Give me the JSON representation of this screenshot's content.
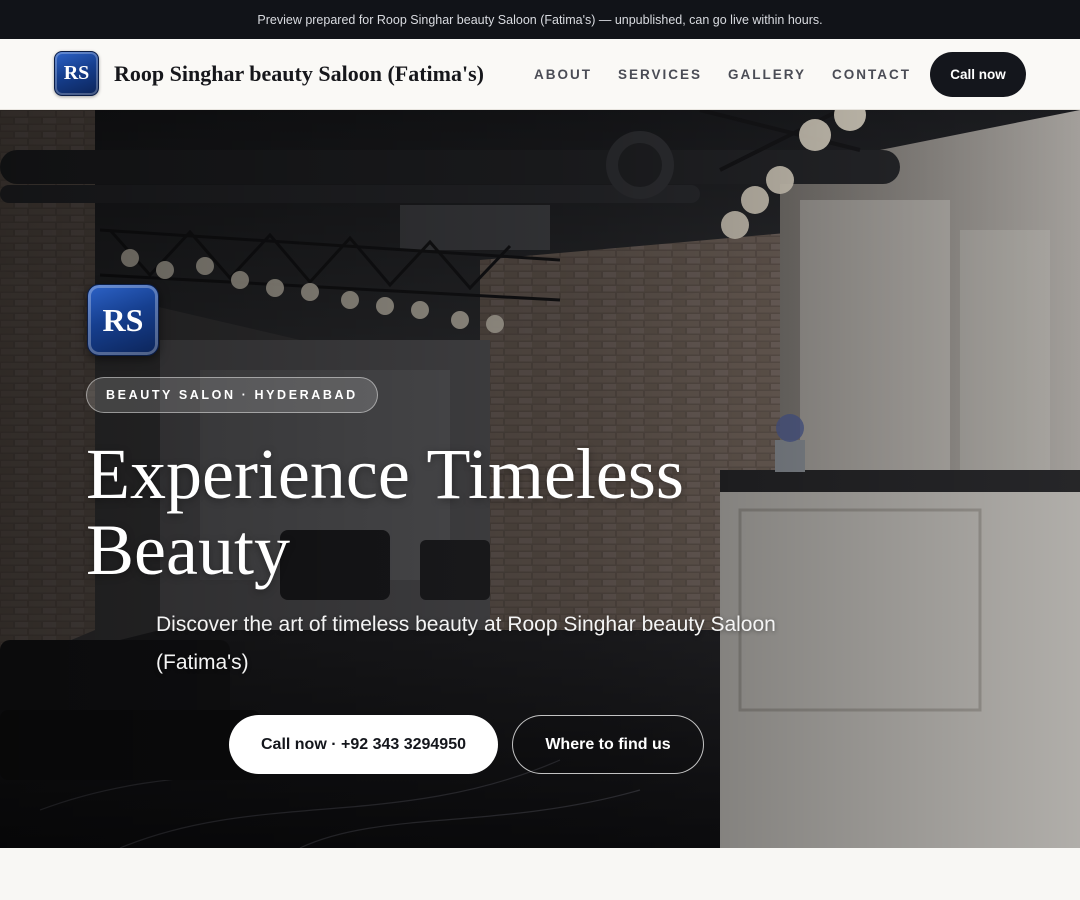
{
  "banner": {
    "text": "Preview prepared for Roop Singhar beauty Saloon (Fatima's) — unpublished, can go live within hours."
  },
  "brand": {
    "logo_initials": "RS",
    "name": "Roop Singhar beauty Saloon (Fatima's)"
  },
  "nav": {
    "links": [
      "ABOUT",
      "SERVICES",
      "GALLERY",
      "CONTACT"
    ],
    "cta_label": "Call now"
  },
  "hero": {
    "background": "salon-interior-photo",
    "logo_initials": "RS",
    "eyebrow": "BEAUTY SALON · HYDERABAD",
    "title": "Experience Timeless Beauty",
    "subtitle": "Discover the art of timeless beauty at Roop Singhar beauty Saloon (Fatima's)",
    "primary_button": "Call now · +92 343 3294950",
    "secondary_button": "Where to find us"
  },
  "colors": {
    "banner_bg": "#111318",
    "nav_bg": "#faf9f6",
    "dark_button": "#14161c",
    "logo_blue": "#163f8f",
    "page_bg": "#f8f7f4"
  }
}
